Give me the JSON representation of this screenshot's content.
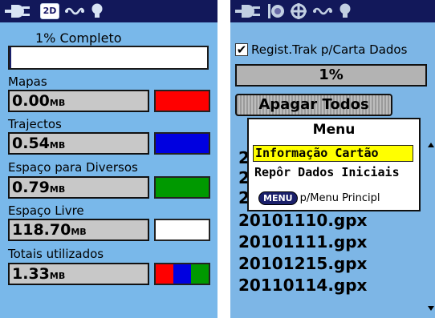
{
  "left_screen": {
    "status_icons": [
      "power-icon",
      "zoom-2d-icon",
      "track-icon",
      "light-icon"
    ],
    "zoom_mode": "2D",
    "progress_label": "1% Completo",
    "progress_value": 0.01,
    "sections": [
      {
        "label": "Mapas",
        "value": "0.00",
        "unit": "MB",
        "color": "#ff0000"
      },
      {
        "label": "Trajectos",
        "value": "0.54",
        "unit": "MB",
        "color": "#0000e0"
      },
      {
        "label": "Espaço para Diversos",
        "value": "0.79",
        "unit": "MB",
        "color": "#009900"
      },
      {
        "label": "Espaço Livre",
        "value": "118.70",
        "unit": "MB",
        "color": "#ffffff"
      },
      {
        "label": "Totais utilizados",
        "value": "1.33",
        "unit": "MB",
        "colors": [
          "#ff0000",
          "#0000e0",
          "#009900"
        ]
      }
    ]
  },
  "right_screen": {
    "status_icons": [
      "power-icon",
      "globe-icon",
      "crosshair-icon",
      "track-icon",
      "light-icon"
    ],
    "checkbox": {
      "label": "Regist.Trak p/Carta Dados",
      "checked": true
    },
    "percent_value": "1%",
    "delete_button": "Apagar Todos",
    "menu": {
      "title": "Menu",
      "items": [
        "Informação Cartão",
        "Repôr Dados Iniciais"
      ],
      "selected_index": 0,
      "footer_key": "MENU",
      "footer_text": "p/Menu Principl"
    },
    "files": [
      "2",
      "2",
      "2",
      "20101110.gpx",
      "20101111.gpx",
      "20101215.gpx",
      "20110114.gpx"
    ]
  }
}
